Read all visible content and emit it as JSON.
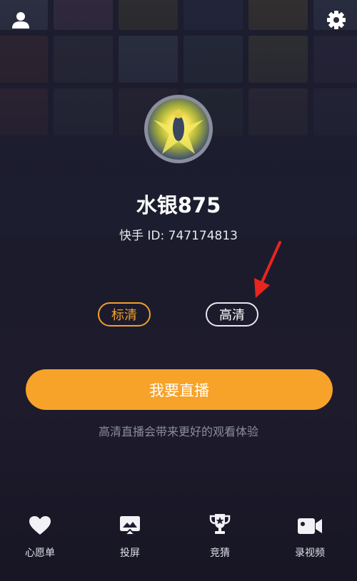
{
  "profile": {
    "name": "水银875",
    "uid_label": "快手 ID: 747174813"
  },
  "quality": {
    "sd_label": "标清",
    "hd_label": "高清",
    "selected": "标清",
    "accent_color": "#f2a02a"
  },
  "live": {
    "button_label": "我要直播",
    "hint": "高清直播会带来更好的观看体验",
    "button_color": "#f7a229"
  },
  "tabbar": {
    "items": [
      {
        "label": "心愿单",
        "icon": "heart-icon"
      },
      {
        "label": "投屏",
        "icon": "cast-icon"
      },
      {
        "label": "竞猜",
        "icon": "trophy-icon"
      },
      {
        "label": "录视频",
        "icon": "video-camera-icon"
      }
    ]
  },
  "header": {
    "left_icon": "user-icon",
    "right_icon": "gear-icon"
  }
}
